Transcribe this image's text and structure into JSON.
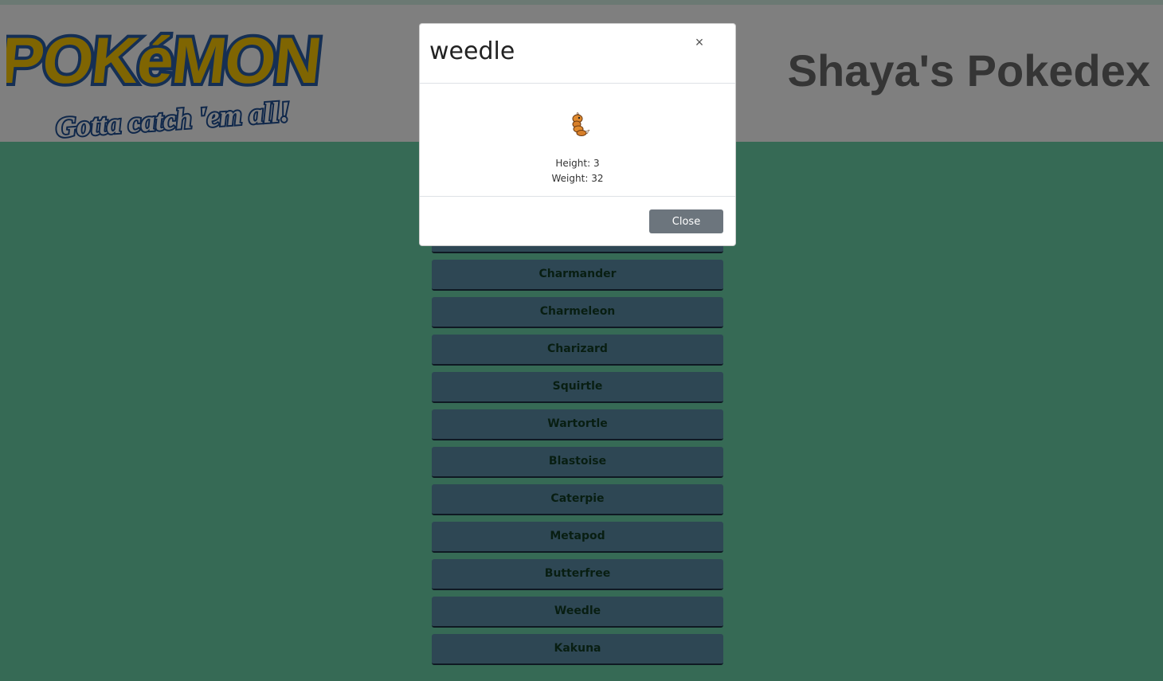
{
  "header": {
    "logo_word": "POKéMON",
    "logo_tagline": "Gotta catch 'em all!",
    "site_title": "Shaya's Pokedex"
  },
  "pokemon_list": [
    "Charmander",
    "Charmeleon",
    "Charizard",
    "Squirtle",
    "Wartortle",
    "Blastoise",
    "Caterpie",
    "Metapod",
    "Butterfree",
    "Weedle",
    "Kakuna"
  ],
  "modal": {
    "title": "weedle",
    "close_icon": "×",
    "height_label": "Height:",
    "height_value": "3",
    "weight_label": "Weight:",
    "weight_value": "32",
    "close_button_label": "Close"
  },
  "colors": {
    "background": "#6cd4ab",
    "button": "#5d8ea8",
    "button_text": "#113d25",
    "close_button": "#6c757d"
  }
}
